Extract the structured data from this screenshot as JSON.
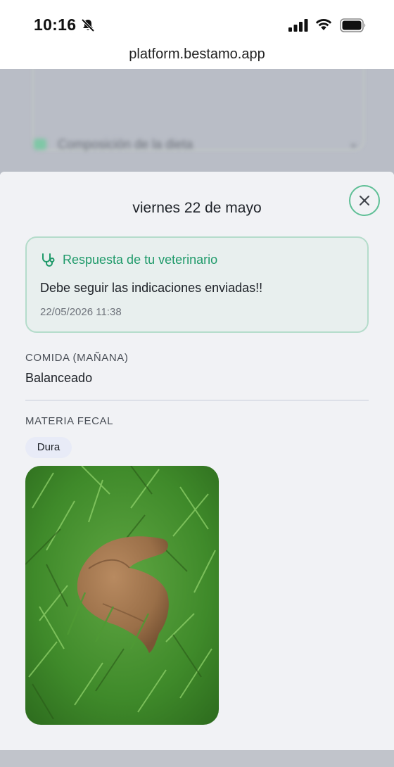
{
  "status_bar": {
    "time": "10:16"
  },
  "browser": {
    "url": "platform.bestamo.app"
  },
  "background_page": {
    "section_label": "Composición de la dieta"
  },
  "sheet": {
    "title": "viernes 22 de mayo",
    "vet_response": {
      "title": "Respuesta de tu veterinario",
      "message": "Debe seguir las indicaciones enviadas!!",
      "timestamp": "22/05/2026 11:38"
    },
    "food": {
      "label": "COMIDA (MAÑANA)",
      "value": "Balanceado"
    },
    "stool": {
      "label": "MATERIA FECAL",
      "tag": "Dura"
    }
  },
  "colors": {
    "accent": "#1f9a6a",
    "accent_border": "#5fbf96",
    "sheet_bg": "#f1f2f5"
  },
  "icons": [
    "bell-slash-icon",
    "signal-icon",
    "wifi-icon",
    "battery-icon",
    "close-icon",
    "stethoscope-icon"
  ]
}
